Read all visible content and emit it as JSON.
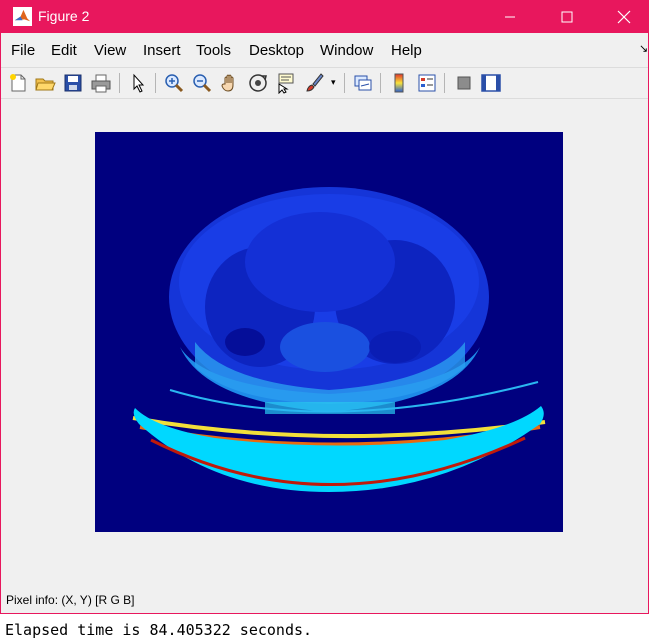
{
  "window": {
    "title": "Figure 2",
    "accent_color": "#e8175d"
  },
  "menu": {
    "file": "File",
    "edit": "Edit",
    "view": "View",
    "insert": "Insert",
    "tools": "Tools",
    "desktop": "Desktop",
    "window": "Window",
    "help": "Help"
  },
  "toolbar_icons": [
    "new-figure-icon",
    "open-file-icon",
    "save-icon",
    "print-icon",
    "edit-plot-icon",
    "zoom-in-icon",
    "zoom-out-icon",
    "pan-icon",
    "rotate-3d-icon",
    "data-cursor-icon",
    "brush-icon",
    "link-plot-icon",
    "colorbar-icon",
    "legend-icon",
    "hide-plot-tools-icon",
    "show-plot-tools-icon"
  ],
  "image": {
    "description_colors": {
      "background": "#00007f",
      "body": "#1030e0",
      "table": "#00d2ff",
      "rim": "#e05010"
    }
  },
  "status": {
    "pixel_info": "Pixel info: (X, Y)  [R G B]"
  },
  "console": {
    "elapsed": "Elapsed time is 84.405322 seconds."
  }
}
